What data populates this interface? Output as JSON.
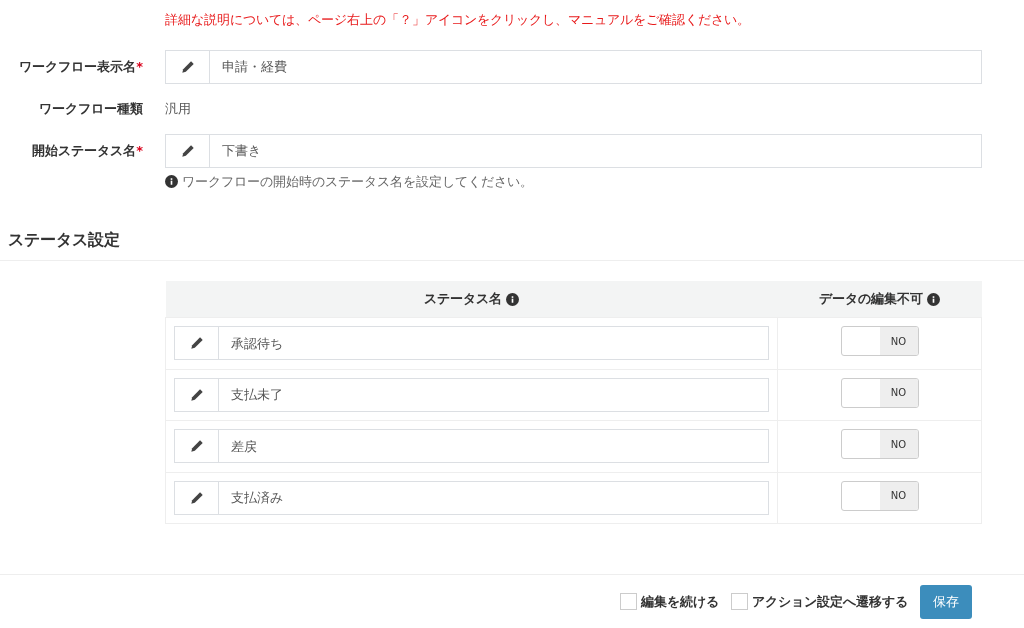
{
  "notice": "詳細な説明については、ページ右上の「？」アイコンをクリックし、マニュアルをご確認ください。",
  "fields": [
    {
      "kind": "input",
      "label": "ワークフロー表示名",
      "required_mark": "*",
      "value": "申請・経費"
    },
    {
      "kind": "text",
      "label": "ワークフロー種類",
      "value": "汎用"
    },
    {
      "kind": "input",
      "label": "開始ステータス名",
      "required_mark": "*",
      "value": "下書き",
      "help": "ワークフローの開始時のステータス名を設定してください。"
    }
  ],
  "section_title": "ステータス設定",
  "table": {
    "columns": [
      "ステータス名",
      "データの編集不可"
    ],
    "rows": [
      {
        "name": "承認待ち",
        "locked": {
          "on": false,
          "label": "NO"
        }
      },
      {
        "name": "支払未了",
        "locked": {
          "on": false,
          "label": "NO"
        }
      },
      {
        "name": "差戻",
        "locked": {
          "on": false,
          "label": "NO"
        }
      },
      {
        "name": "支払済み",
        "locked": {
          "on": false,
          "label": "NO"
        }
      }
    ]
  },
  "footer": {
    "options": [
      {
        "label": "編集を続ける",
        "checked": false
      },
      {
        "label": "アクション設定へ遷移する",
        "checked": false
      }
    ],
    "save": "保存"
  }
}
